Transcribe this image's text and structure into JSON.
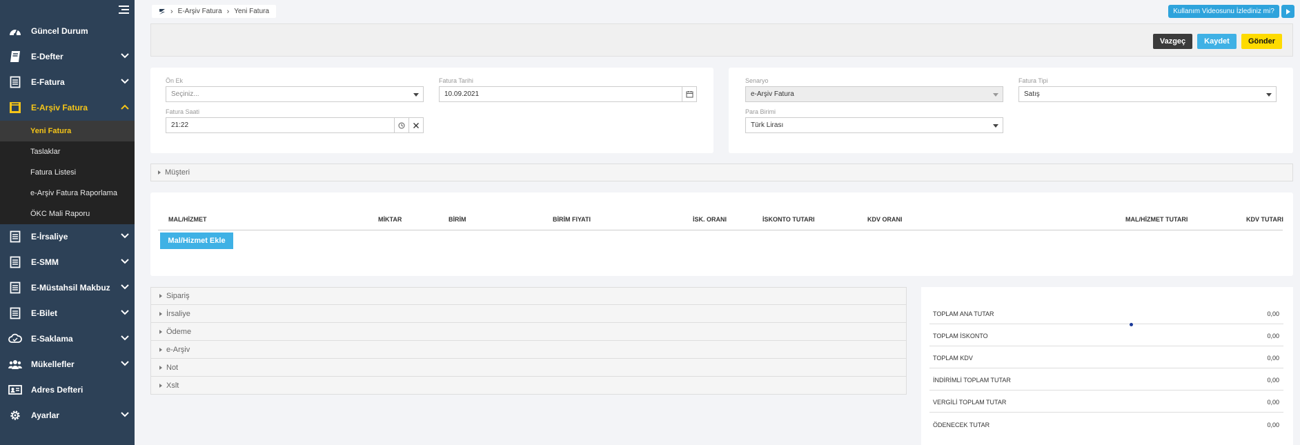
{
  "sidebar": {
    "items": [
      {
        "label": "Güncel Durum",
        "icon": "speedometer-icon"
      },
      {
        "label": "E-Defter",
        "icon": "book-icon"
      },
      {
        "label": "E-Fatura",
        "icon": "receipt-icon"
      },
      {
        "label": "E-Arşiv Fatura",
        "icon": "archive-invoice-icon"
      },
      {
        "label": "E-İrsaliye",
        "icon": "receipt-icon"
      },
      {
        "label": "E-SMM",
        "icon": "receipt-icon"
      },
      {
        "label": "E-Müstahsil Makbuz",
        "icon": "receipt-icon"
      },
      {
        "label": "E-Bilet",
        "icon": "receipt-icon"
      },
      {
        "label": "E-Saklama",
        "icon": "cloud-icon"
      },
      {
        "label": "Mükellefler",
        "icon": "users-icon"
      },
      {
        "label": "Adres Defteri",
        "icon": "address-card-icon"
      },
      {
        "label": "Ayarlar",
        "icon": "gear-icon"
      }
    ],
    "subitems": [
      "Yeni Fatura",
      "Taslaklar",
      "Fatura Listesi",
      "e-Arşiv Fatura Raporlama",
      "ÖKC Mali Raporu"
    ]
  },
  "breadcrumb": {
    "items": [
      "E-Arşiv Fatura",
      "Yeni Fatura"
    ]
  },
  "header": {
    "video_label": "Kullanım Videosunu İzlediniz mi?"
  },
  "actions": {
    "cancel": "Vazgeç",
    "save": "Kaydet",
    "send": "Gönder"
  },
  "form": {
    "prefix_label": "Ön Ek",
    "prefix_placeholder": "Seçiniz...",
    "date_label": "Fatura Tarihi",
    "date_value": "10.09.2021",
    "time_label": "Fatura Saati",
    "time_value": "21:22",
    "scenario_label": "Senaryo",
    "scenario_value": "e-Arşiv Fatura",
    "type_label": "Fatura Tipi",
    "type_value": "Satış",
    "currency_label": "Para Birimi",
    "currency_value": "Türk Lirası"
  },
  "customer_section": "Müşteri",
  "table": {
    "headers": [
      "MAL/HİZMET",
      "MİKTAR",
      "BİRİM",
      "BİRİM FIYATI",
      "İSK. ORANI",
      "İSKONTO TUTARI",
      "KDV ORANI",
      "MAL/HİZMET TUTARI",
      "KDV TUTARI"
    ],
    "add_button": "Mal/Hizmet Ekle"
  },
  "sections": [
    "Sipariş",
    "İrsaliye",
    "Ödeme",
    "e-Arşiv",
    "Not",
    "Xslt"
  ],
  "totals": [
    {
      "label": "TOPLAM ANA TUTAR",
      "value": "0,00"
    },
    {
      "label": "TOPLAM İSKONTO",
      "value": "0,00"
    },
    {
      "label": "TOPLAM KDV",
      "value": "0,00"
    },
    {
      "label": "İNDİRİMLİ TOPLAM TUTAR",
      "value": "0,00"
    },
    {
      "label": "VERGİLİ TOPLAM TUTAR",
      "value": "0,00"
    },
    {
      "label": "ÖDENECEK TUTAR",
      "value": "0,00"
    }
  ],
  "colors": {
    "sidebar": "#2d4157",
    "accent_yellow": "#f5c518",
    "button_blue": "#3fb1e5",
    "send_yellow": "#fedb00"
  }
}
